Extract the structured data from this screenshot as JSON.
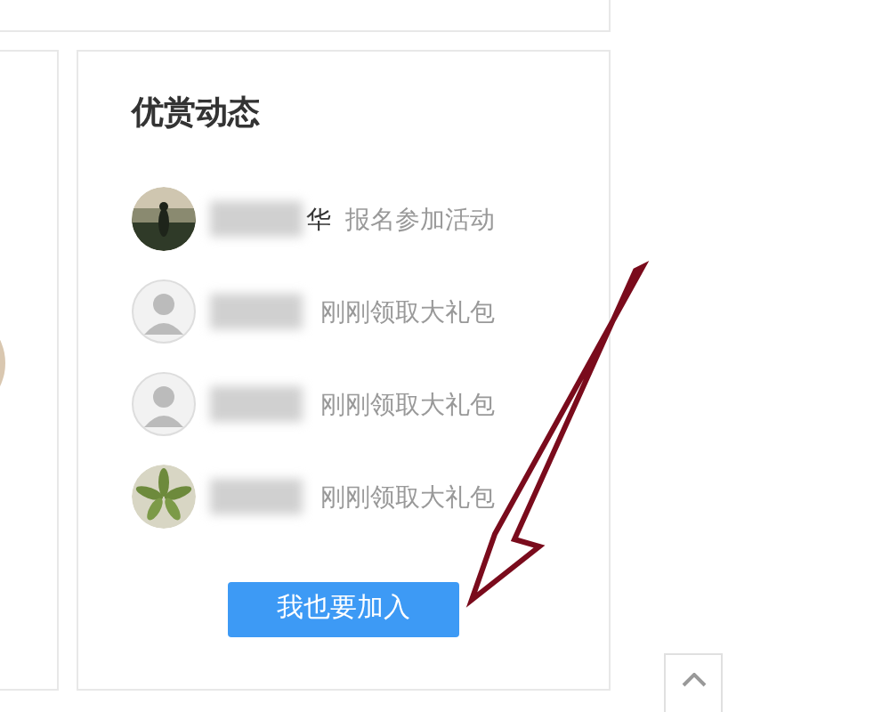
{
  "panel": {
    "title": "优赏动态",
    "feed": [
      {
        "kind": "picture",
        "name_tail": "华",
        "action": "报名参加活动"
      },
      {
        "kind": "avatar",
        "action": "刚刚领取大礼包"
      },
      {
        "kind": "avatar",
        "action": "刚刚领取大礼包"
      },
      {
        "kind": "picture",
        "action": "刚刚领取大礼包"
      }
    ],
    "button": "我也要加入"
  }
}
